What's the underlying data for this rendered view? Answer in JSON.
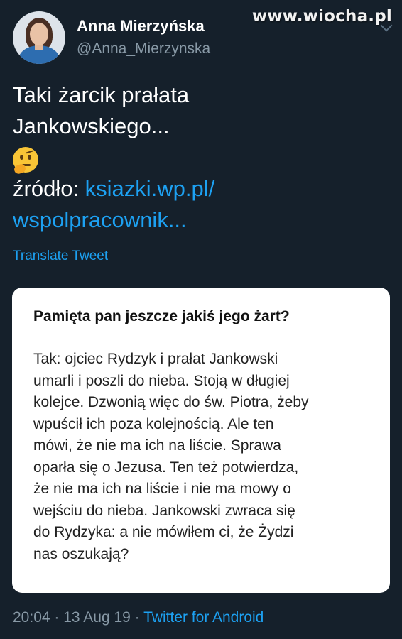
{
  "watermark": "www.wiocha.pl",
  "author": {
    "display_name": "Anna Mierzyńska",
    "handle": "@Anna_Mierzynska"
  },
  "tweet": {
    "text_line1": "Taki żarcik prałata",
    "text_line2": "Jankowskiego...",
    "emoji": "thinking-face",
    "source_label": "źródło: ",
    "link_line1": "ksiazki.wp.pl/",
    "link_line2": "wspolpracownik..."
  },
  "translate_label": "Translate Tweet",
  "card": {
    "question": "Pamięta pan jeszcze jakiś jego żart?",
    "answer_lines": [
      "Tak: ojciec Rydzyk i prałat Jankowski",
      "umarli i poszli do nieba. Stoją w długiej",
      "kolejce. Dzwonią więc do św. Piotra, żeby",
      "wpuścił ich poza kolejnością. Ale ten",
      "mówi, że nie ma ich na liście. Sprawa",
      "oparła się o Jezusa. Ten też potwierdza,",
      "że nie ma ich na liście i nie ma mowy o",
      "wejściu do nieba. Jankowski zwraca się",
      "do Rydzyka: a nie mówiłem ci, że Żydzi",
      "nas oszukają?"
    ]
  },
  "footer": {
    "time": "20:04",
    "separator": " · ",
    "date": "13 Aug 19",
    "via": "Twitter for Android"
  },
  "colors": {
    "background": "#15202b",
    "link": "#1da1f2",
    "muted": "#8899a6",
    "card": "#ffffff"
  }
}
